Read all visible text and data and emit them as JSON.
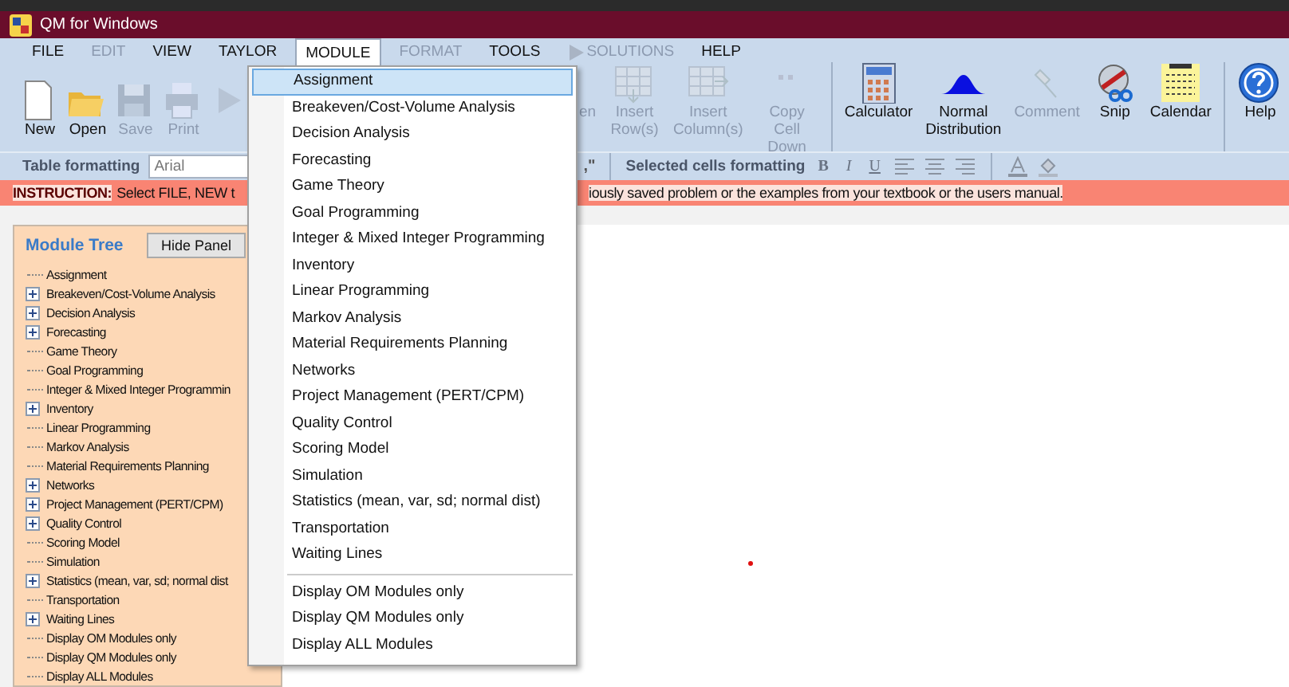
{
  "window": {
    "title": "QM for Windows"
  },
  "menu_bar": [
    {
      "label": "FILE",
      "disabled": false,
      "selected": false
    },
    {
      "label": "EDIT",
      "disabled": true,
      "selected": false
    },
    {
      "label": "VIEW",
      "disabled": false,
      "selected": false
    },
    {
      "label": "TAYLOR",
      "disabled": false,
      "selected": false
    },
    {
      "label": "MODULE",
      "disabled": false,
      "selected": true
    },
    {
      "label": "FORMAT",
      "disabled": true,
      "selected": false
    },
    {
      "label": "TOOLS",
      "disabled": false,
      "selected": false
    },
    {
      "label": "SOLUTIONS",
      "disabled": true,
      "selected": false,
      "kind": "run"
    },
    {
      "label": "HELP",
      "disabled": false,
      "selected": false
    }
  ],
  "toolbar": {
    "left": [
      {
        "kind": "new",
        "label": "New",
        "disabled": false
      },
      {
        "kind": "open",
        "label": "Open",
        "disabled": false
      },
      {
        "kind": "save",
        "label": "Save",
        "disabled": true
      },
      {
        "kind": "print",
        "label": "Print",
        "disabled": true
      },
      {
        "kind": "run",
        "disabled": true
      }
    ],
    "right": [
      {
        "kind": "partial",
        "label": "en",
        "disabled": true
      },
      {
        "kind": "insert_row",
        "label": "Insert Row(s)",
        "disabled": true
      },
      {
        "kind": "insert_column",
        "label": "Insert Column(s)",
        "disabled": true
      },
      {
        "kind": "copy_down",
        "label": "Copy Cell Down",
        "disabled": true
      },
      {
        "kind": "calculator",
        "label": "Calculator",
        "disabled": false
      },
      {
        "kind": "normal",
        "label": "Normal Distribution",
        "disabled": false
      },
      {
        "kind": "comment",
        "label": "Comment",
        "disabled": true
      },
      {
        "kind": "snip",
        "label": "Snip",
        "disabled": false
      },
      {
        "kind": "calendar",
        "label": "Calendar",
        "disabled": false
      },
      {
        "kind": "help",
        "label": "Help",
        "disabled": false
      }
    ]
  },
  "format_bar": {
    "table_label": "Table formatting",
    "font_value": "Arial",
    "partial_text": ",\"",
    "selected_label": "Selected cells formatting",
    "buttons": [
      {
        "kind": "bold",
        "label": "B"
      },
      {
        "kind": "italic",
        "label": "I"
      },
      {
        "kind": "underline",
        "label": "U"
      },
      {
        "kind": "align_left"
      },
      {
        "kind": "align_center"
      },
      {
        "kind": "align_right"
      },
      {
        "kind": "font_color"
      },
      {
        "kind": "fill_color"
      }
    ]
  },
  "instruction": {
    "label": "INSTRUCTION:",
    "text_start": "Select FILE, NEW t",
    "text_end": "iously saved problem or the examples from your textbook or the users manual."
  },
  "module_tree": {
    "title": "Module Tree",
    "hide_button": "Hide Panel",
    "items": [
      {
        "label": "Assignment",
        "expandable": false
      },
      {
        "label": "Breakeven/Cost-Volume Analysis",
        "expandable": true
      },
      {
        "label": "Decision Analysis",
        "expandable": true
      },
      {
        "label": "Forecasting",
        "expandable": true
      },
      {
        "label": "Game Theory",
        "expandable": false
      },
      {
        "label": "Goal Programming",
        "expandable": false
      },
      {
        "label": "Integer & Mixed Integer Programmin",
        "expandable": false
      },
      {
        "label": "Inventory",
        "expandable": true
      },
      {
        "label": "Linear Programming",
        "expandable": false
      },
      {
        "label": "Markov Analysis",
        "expandable": false
      },
      {
        "label": "Material Requirements Planning",
        "expandable": false
      },
      {
        "label": "Networks",
        "expandable": true
      },
      {
        "label": "Project Management (PERT/CPM)",
        "expandable": true
      },
      {
        "label": "Quality Control",
        "expandable": true
      },
      {
        "label": "Scoring Model",
        "expandable": false
      },
      {
        "label": "Simulation",
        "expandable": false
      },
      {
        "label": "Statistics (mean, var, sd; normal dist",
        "expandable": true
      },
      {
        "label": "Transportation",
        "expandable": false
      },
      {
        "label": "Waiting Lines",
        "expandable": true
      },
      {
        "label": "Display OM Modules only",
        "expandable": false
      },
      {
        "label": "Display QM Modules only",
        "expandable": false
      },
      {
        "label": "Display ALL Modules",
        "expandable": false
      }
    ]
  },
  "module_menu": {
    "groups": [
      [
        {
          "label": "Assignment",
          "selected": true
        },
        {
          "label": "Breakeven/Cost-Volume Analysis",
          "selected": false
        },
        {
          "label": "Decision Analysis",
          "selected": false
        },
        {
          "label": "Forecasting",
          "selected": false
        },
        {
          "label": "Game Theory",
          "selected": false
        },
        {
          "label": "Goal Programming",
          "selected": false
        },
        {
          "label": "Integer & Mixed Integer Programming",
          "selected": false
        },
        {
          "label": "Inventory",
          "selected": false
        },
        {
          "label": "Linear Programming",
          "selected": false
        },
        {
          "label": "Markov Analysis",
          "selected": false
        },
        {
          "label": "Material Requirements Planning",
          "selected": false
        },
        {
          "label": "Networks",
          "selected": false
        },
        {
          "label": "Project Management (PERT/CPM)",
          "selected": false
        },
        {
          "label": "Quality Control",
          "selected": false
        },
        {
          "label": "Scoring Model",
          "selected": false
        },
        {
          "label": "Simulation",
          "selected": false
        },
        {
          "label": "Statistics (mean, var, sd; normal dist)",
          "selected": false
        },
        {
          "label": "Transportation",
          "selected": false
        },
        {
          "label": "Waiting Lines",
          "selected": false
        }
      ],
      [
        {
          "label": "Display OM Modules only",
          "selected": false
        },
        {
          "label": "Display QM Modules only",
          "selected": false
        },
        {
          "label": "Display ALL Modules",
          "selected": false
        }
      ]
    ]
  }
}
